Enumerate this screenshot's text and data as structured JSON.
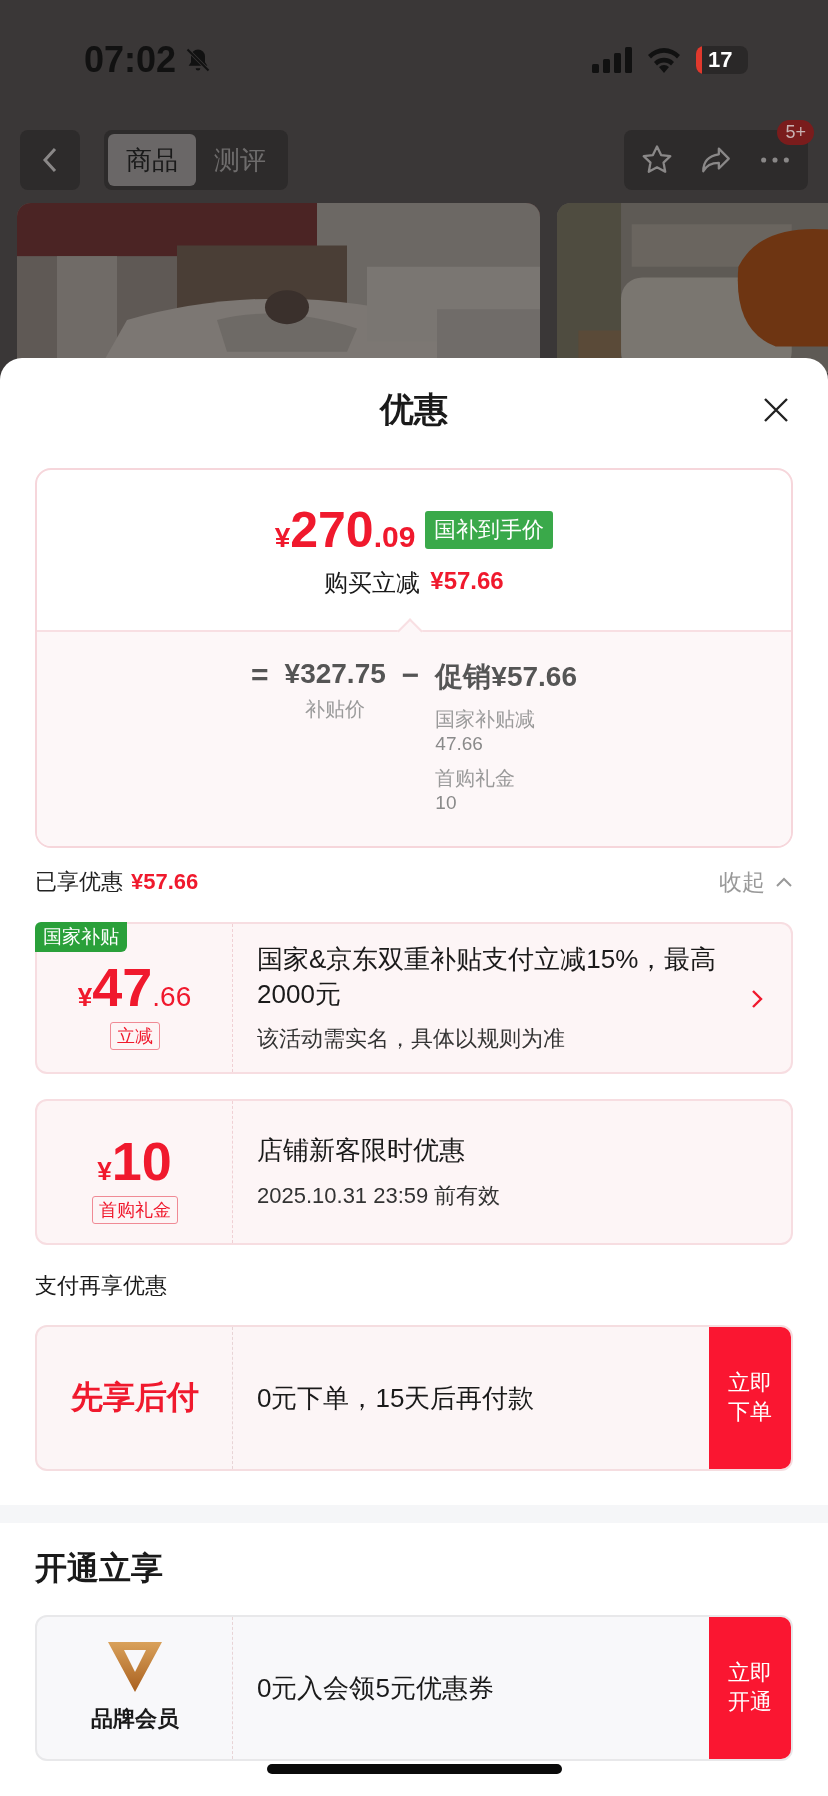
{
  "status_bar": {
    "time": "07:02",
    "battery": "17"
  },
  "nav": {
    "tabs": [
      {
        "label": "商品",
        "selected": true
      },
      {
        "label": "测评",
        "selected": false
      }
    ],
    "badge": "5+"
  },
  "sheet": {
    "title": "优惠",
    "price_card": {
      "currency": "¥",
      "integer": "270",
      "decimal": ".09",
      "tag": "国补到手价",
      "reduction_label": "购买立减",
      "reduction_value": "¥57.66",
      "equals_sign": "=",
      "base_price": "¥327.75",
      "base_label": "补贴价",
      "minus_sign": "−",
      "promo": "促销¥57.66",
      "details": [
        {
          "label": "国家补贴减",
          "value": "47.66"
        },
        {
          "label": "首购礼金",
          "value": "10"
        }
      ]
    },
    "enjoyed": {
      "label": "已享优惠",
      "amount": "¥57.66",
      "toggle": "收起",
      "expanded": true
    },
    "coupons": [
      {
        "kind": "link",
        "corner_tag": "国家补贴",
        "currency": "¥",
        "integer": "47",
        "decimal": ".66",
        "tag": "立减",
        "title": "国家&京东双重补贴支付立减15%，最高2000元",
        "note": "该活动需实名，具体以规则为准"
      },
      {
        "kind": "plain",
        "currency": "¥",
        "integer": "10",
        "tag": "首购礼金",
        "title": "店铺新客限时优惠",
        "note": "2025.10.31 23:59 前有效"
      }
    ],
    "pay_section": {
      "title": "支付再享优惠",
      "offers": [
        {
          "kind": "text",
          "left": "先享后付",
          "text": "0元下单，15天后再付款",
          "action": "立即下单"
        }
      ]
    },
    "open_section": {
      "title": "开通立享",
      "offers": [
        {
          "kind": "logo",
          "left": "品牌会员",
          "text": "0元入会领5元优惠券",
          "action": "立即开通"
        }
      ]
    }
  }
}
